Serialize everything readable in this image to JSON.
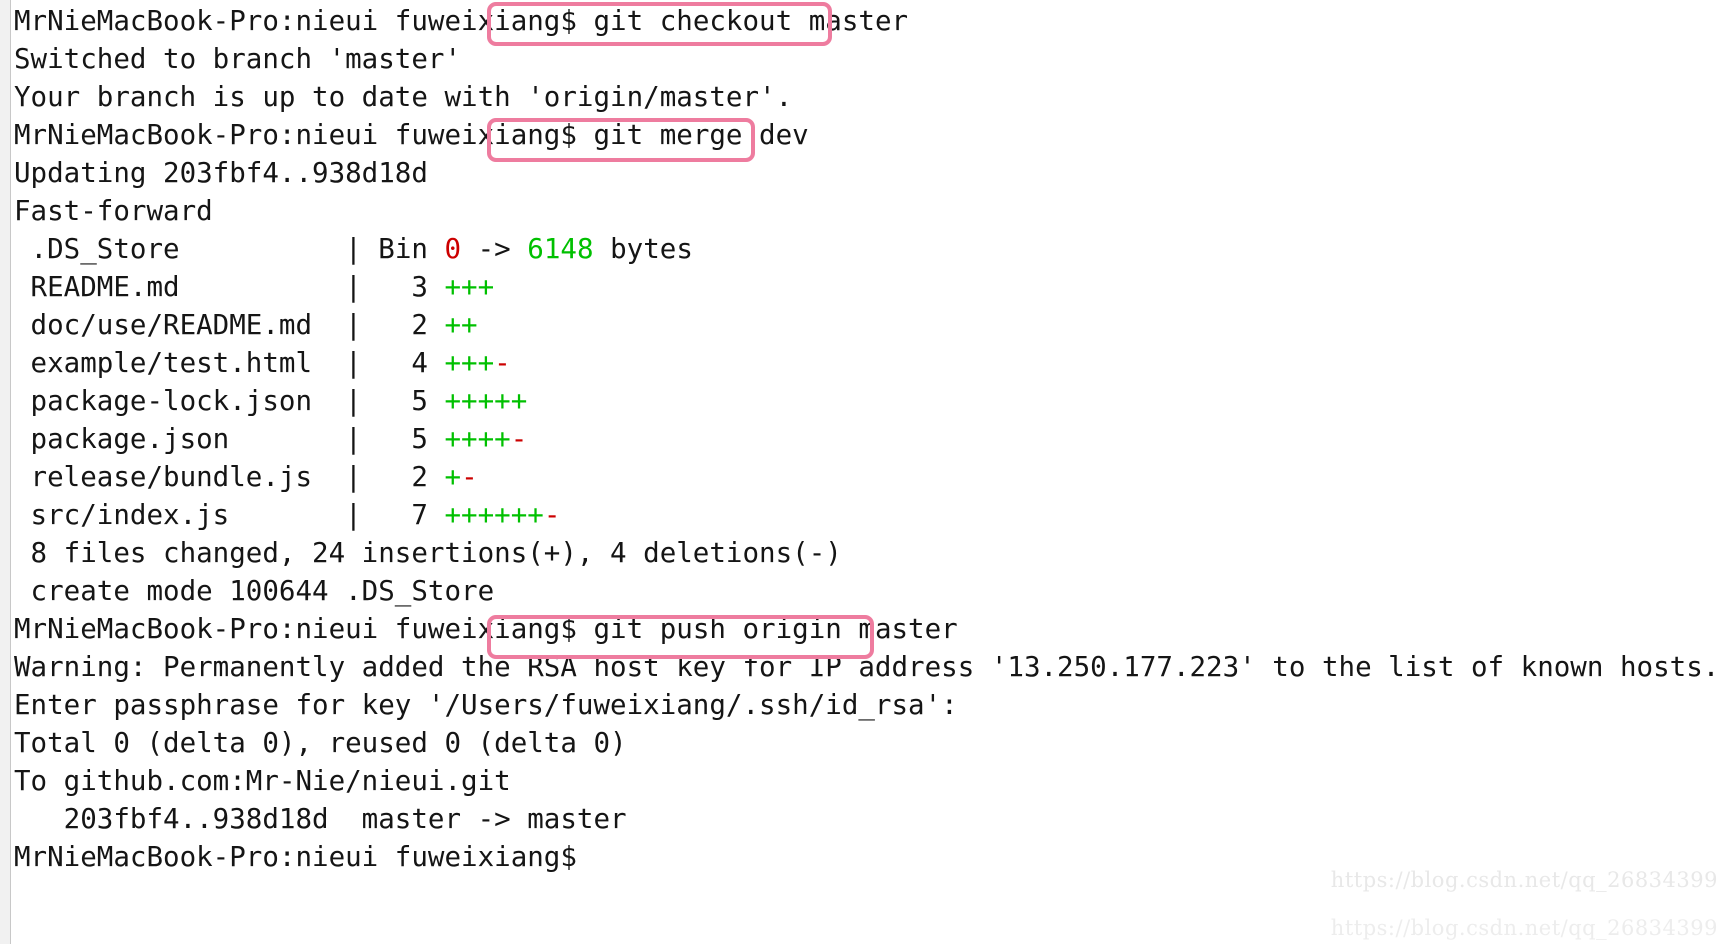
{
  "terminal": {
    "prompt": "MrNieMacBook-Pro:nieui fuweixiang$ ",
    "colors": {
      "background": "#ffffff",
      "foreground": "#151515",
      "highlight_box": "#ee7c9f",
      "insertion_green": "#00c000",
      "deletion_red": "#cc0000",
      "gutter": "#f1f1f1"
    },
    "lines": [
      {
        "id": "l1",
        "prompt": "MrNieMacBook-Pro:nieui fuweixiang$ ",
        "command": "git checkout master",
        "boxed": true
      },
      {
        "id": "l2",
        "text": "Switched to branch 'master'"
      },
      {
        "id": "l3",
        "text": "Your branch is up to date with 'origin/master'."
      },
      {
        "id": "l4",
        "prompt": "MrNieMacBook-Pro:nieui fuweixiang$ ",
        "command": "git merge dev",
        "boxed": true
      },
      {
        "id": "l5",
        "text": "Updating 203fbf4..938d18d"
      },
      {
        "id": "l6",
        "text": "Fast-forward"
      },
      {
        "id": "l7",
        "file": " .DS_Store          ",
        "sep": "| ",
        "stat": "Bin ",
        "bin_from": "0",
        "bin_arrow": " -> ",
        "bin_to": "6148",
        "bin_unit": " bytes"
      },
      {
        "id": "l8",
        "file": " README.md          ",
        "sep": "|   ",
        "count": "3 ",
        "plus": "+++",
        "minus": ""
      },
      {
        "id": "l9",
        "file": " doc/use/README.md  ",
        "sep": "|   ",
        "count": "2 ",
        "plus": "++",
        "minus": ""
      },
      {
        "id": "l10",
        "file": " example/test.html  ",
        "sep": "|   ",
        "count": "4 ",
        "plus": "+++",
        "minus": "-"
      },
      {
        "id": "l11",
        "file": " package-lock.json  ",
        "sep": "|   ",
        "count": "5 ",
        "plus": "+++++",
        "minus": ""
      },
      {
        "id": "l12",
        "file": " package.json       ",
        "sep": "|   ",
        "count": "5 ",
        "plus": "++++",
        "minus": "-"
      },
      {
        "id": "l13",
        "file": " release/bundle.js  ",
        "sep": "|   ",
        "count": "2 ",
        "plus": "+",
        "minus": "-"
      },
      {
        "id": "l14",
        "file": " src/index.js       ",
        "sep": "|   ",
        "count": "7 ",
        "plus": "++++++",
        "minus": "-"
      },
      {
        "id": "l15",
        "text": " 8 files changed, 24 insertions(+), 4 deletions(-)"
      },
      {
        "id": "l16",
        "text": " create mode 100644 .DS_Store"
      },
      {
        "id": "l17",
        "prompt": "MrNieMacBook-Pro:nieui fuweixiang$ ",
        "command": "git push origin master",
        "boxed": true
      },
      {
        "id": "l18",
        "text": "Warning: Permanently added the RSA host key for IP address '13.250.177.223' to the list of known hosts."
      },
      {
        "id": "l19",
        "text": "Enter passphrase for key '/Users/fuweixiang/.ssh/id_rsa':"
      },
      {
        "id": "l20",
        "text": "Total 0 (delta 0), reused 0 (delta 0)"
      },
      {
        "id": "l21",
        "text": "To github.com:Mr-Nie/nieui.git"
      },
      {
        "id": "l22",
        "text": "   203fbf4..938d18d  master -> master"
      },
      {
        "id": "l23",
        "text": "MrNieMacBook-Pro:nieui fuweixiang$ "
      }
    ]
  },
  "watermark": {
    "text_a": "https://blog.csdn.net/qq_26834399",
    "text_b": "https://blog.csdn.net/qq_26834399"
  }
}
